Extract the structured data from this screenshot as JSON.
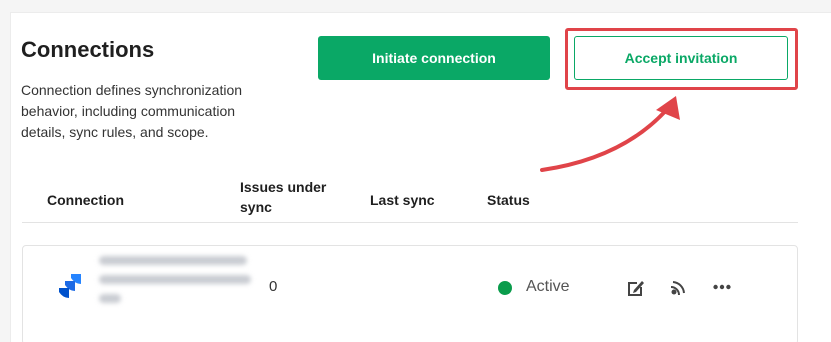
{
  "header": {
    "title": "Connections",
    "description": "Connection defines synchronization behavior, including communication details, sync rules, and scope."
  },
  "actions": {
    "initiate_label": "Initiate connection",
    "accept_label": "Accept invitation"
  },
  "table": {
    "columns": [
      "Connection",
      "Issues under sync",
      "Last sync",
      "Status"
    ],
    "rows": [
      {
        "connection_icon": "jira-icon",
        "issues_under_sync": "0",
        "last_sync": "",
        "status": "Active",
        "row_actions": [
          "edit-icon",
          "sync-icon",
          "more-icon"
        ]
      }
    ]
  },
  "colors": {
    "primary_green": "#0aa866",
    "status_active": "#0a9c4c",
    "highlight_red": "#e04449",
    "jira_blue": "#2684ff"
  }
}
